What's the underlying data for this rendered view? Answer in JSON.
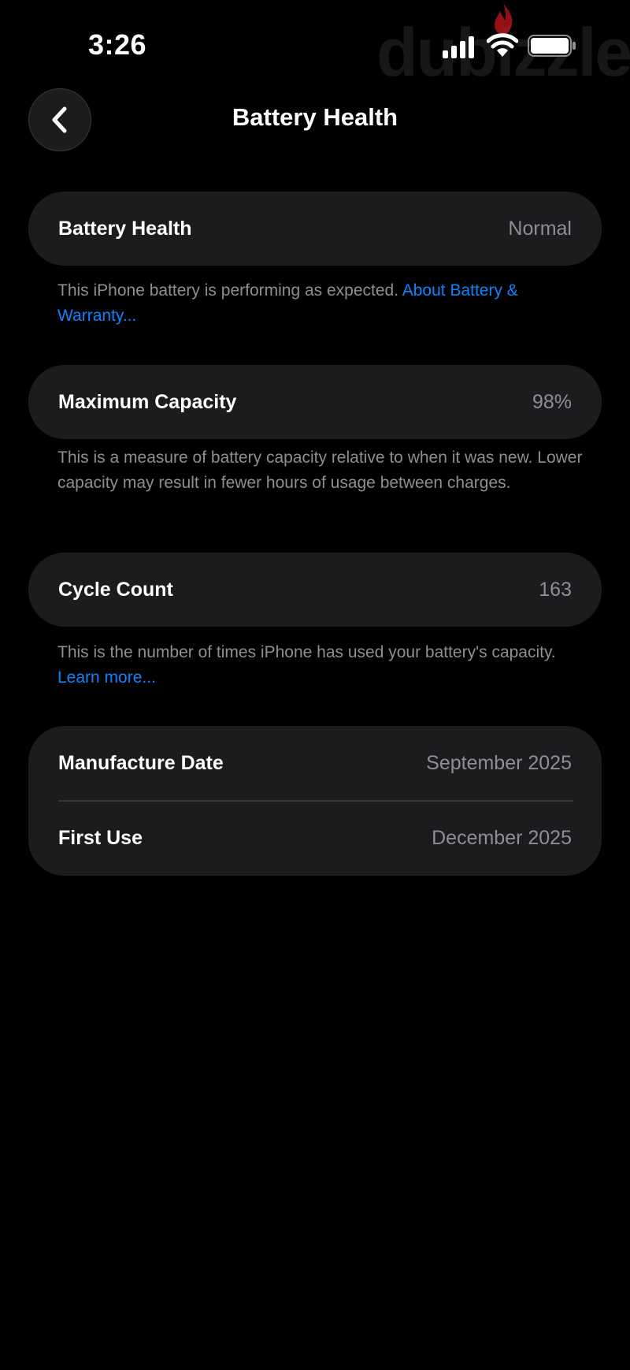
{
  "status_bar": {
    "time": "3:26",
    "watermark": "dubizzle",
    "signal_icon": "cellular-signal-icon",
    "wifi_icon": "wifi-icon",
    "battery_icon": "battery-icon"
  },
  "nav": {
    "back_icon": "chevron-left-icon",
    "title": "Battery Health"
  },
  "sections": {
    "battery_health": {
      "label": "Battery Health",
      "value": "Normal",
      "footnote": "This iPhone battery is performing as expected. ",
      "footnote_link": "About Battery & Warranty..."
    },
    "maximum_capacity": {
      "label": "Maximum Capacity",
      "value": "98%",
      "footnote": "This is a measure of battery capacity relative to when it was new. Lower capacity may result in fewer hours of usage between charges."
    },
    "cycle_count": {
      "label": "Cycle Count",
      "value": "163",
      "footnote": "This is the number of times iPhone has used your battery's capacity. ",
      "footnote_link": "Learn more..."
    },
    "dates": {
      "manufacture_label": "Manufacture Date",
      "manufacture_value": "September 2025",
      "first_use_label": "First Use",
      "first_use_value": "December 2025"
    }
  },
  "colors": {
    "background": "#000000",
    "card": "#1c1c1e",
    "secondary_text": "#8e8e93",
    "link": "#0a84ff"
  }
}
